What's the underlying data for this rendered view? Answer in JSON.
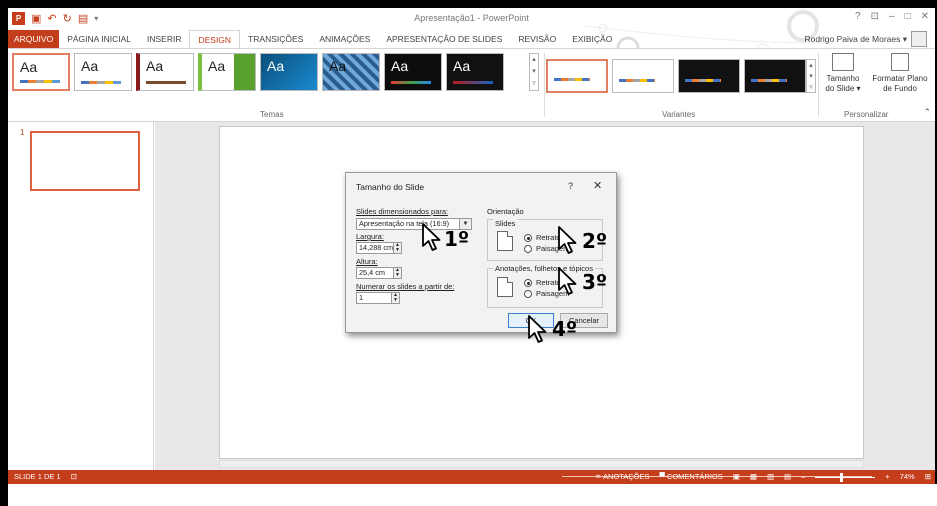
{
  "window": {
    "title": "Apresentação1 - PowerPoint",
    "controls": [
      "?",
      "⊡",
      "–",
      "□",
      "✕"
    ]
  },
  "ribbon_tabs": [
    {
      "label": "ARQUIVO"
    },
    {
      "label": "PÁGINA INICIAL"
    },
    {
      "label": "INSERIR"
    },
    {
      "label": "DESIGN"
    },
    {
      "label": "TRANSIÇÕES"
    },
    {
      "label": "ANIMAÇÕES"
    },
    {
      "label": "APRESENTAÇÃO DE SLIDES"
    },
    {
      "label": "REVISÃO"
    },
    {
      "label": "EXIBIÇÃO"
    }
  ],
  "active_tab": "DESIGN",
  "user": {
    "name": "Rodrigo Paiva de Moraes ▾"
  },
  "ribbon": {
    "themes_label": "Temas",
    "variants_label": "Variantes",
    "customize_label": "Personalizar",
    "theme_tiles": [
      "Aa",
      "Aa",
      "Aa",
      "Aa",
      "Aa",
      "Aa",
      "Aa",
      "Aa"
    ],
    "slide_size_button": {
      "line1": "Tamanho",
      "line2": "do Slide ▾"
    },
    "format_bg_button": {
      "line1": "Formatar Plano",
      "line2": "de Fundo"
    }
  },
  "thumbnails": {
    "slide_number": "1"
  },
  "statusbar": {
    "slide_info": "SLIDE 1 DE 1",
    "notes": "≐ ANOTAÇÕES",
    "comments": "▀ COMENTÁRIOS",
    "zoom": "74%"
  },
  "dialog": {
    "title": "Tamanho do Slide",
    "help": "?",
    "close": "✕",
    "sized_for_label": "Slides dimensionados para:",
    "sized_for_value": "Apresentação na tela (16:9)",
    "width_label": "Largura:",
    "width_value": "14,288 cm",
    "height_label": "Altura:",
    "height_value": "25,4 cm",
    "number_from_label": "Numerar os slides a partir de:",
    "number_from_value": "1",
    "orientation_label": "Orientação",
    "slides_group_label": "Slides",
    "slides_portrait": "Retrato",
    "slides_landscape": "Paisagem",
    "notes_group_label": "Anotações, folhetos e tópicos",
    "notes_portrait": "Retrato",
    "notes_landscape": "Paisagem",
    "ok_label": "OK",
    "cancel_label": "Cancelar"
  },
  "annotations": {
    "step1": "1º",
    "step2": "2º",
    "step3": "3º",
    "step4": "4º"
  },
  "colors": {
    "accent": "#c43e1c",
    "dialog_bg": "#f2f2f2",
    "ok_border": "#3c7fd1"
  }
}
